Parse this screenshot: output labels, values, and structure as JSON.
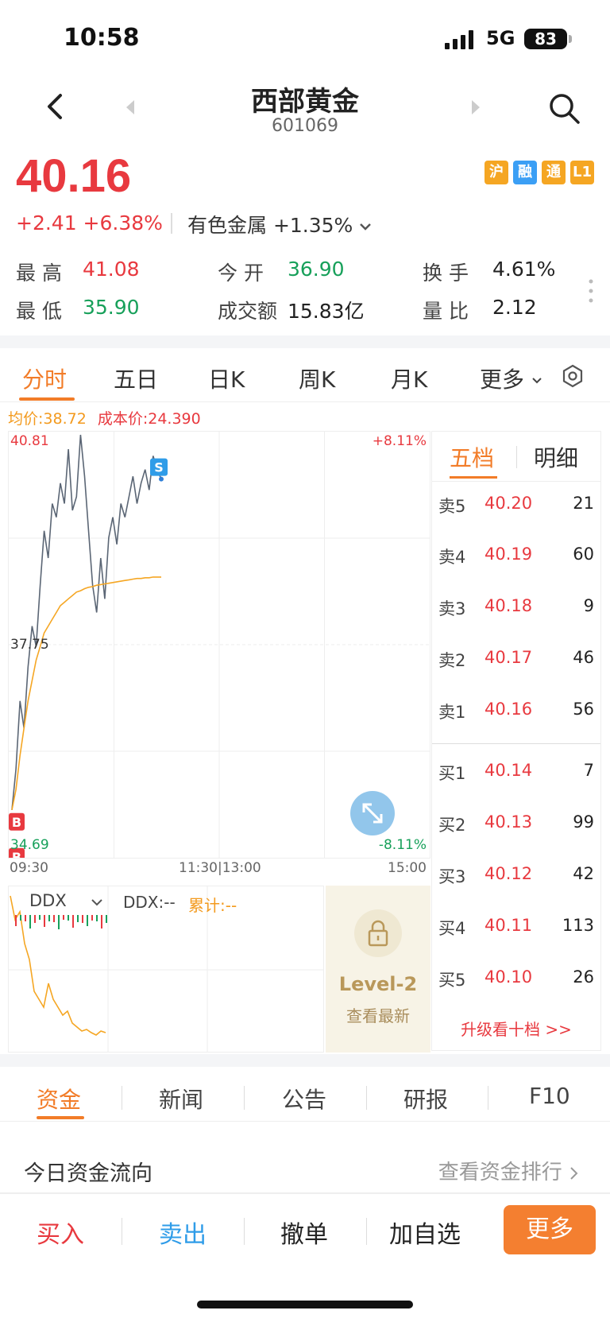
{
  "status_bar": {
    "time": "10:58",
    "network": "5G",
    "battery": "83"
  },
  "nav": {
    "name": "西部黄金",
    "code": "601069"
  },
  "header": {
    "price": "40.16",
    "change": "+2.41  +6.38%",
    "sector": "有色金属 +1.35%",
    "badges": [
      {
        "label": "沪",
        "color": "#f5a623"
      },
      {
        "label": "融",
        "color": "#3b9ff5"
      },
      {
        "label": "通",
        "color": "#f5a623"
      },
      {
        "label": "L1",
        "color": "#f5a623"
      }
    ]
  },
  "stats": {
    "high_label": "最  高",
    "high": "41.08",
    "low_label": "最  低",
    "low": "35.90",
    "open_label": "今  开",
    "open": "36.90",
    "amount_label": "成交额",
    "amount": "15.83亿",
    "turnover_label": "换  手",
    "turnover": "4.61%",
    "ratio_label": "量  比",
    "ratio": "2.12"
  },
  "chart_tabs": [
    "分时",
    "五日",
    "日K",
    "周K",
    "月K",
    "更多"
  ],
  "chart_info": {
    "avg_price": "均价:38.72",
    "cost_price": "成本价:24.390"
  },
  "chart_data": {
    "type": "line",
    "y_max_label": "40.81",
    "y_mid_label": "37.75",
    "y_min_label": "34.69",
    "pct_max_label": "+8.11%",
    "pct_min_label": "-8.11%",
    "x_labels": [
      "09:30",
      "11:30|13:00",
      "15:00"
    ],
    "ylim": [
      34.69,
      40.81
    ],
    "series": [
      {
        "values": [
          35.3,
          35.9,
          36.9,
          36.5,
          37.4,
          38.0,
          37.7,
          38.6,
          39.4,
          39.0,
          39.8,
          39.6,
          40.1,
          39.8,
          40.6,
          39.7,
          39.9,
          40.81,
          40.2,
          39.4,
          38.6,
          38.2,
          39.0,
          38.4,
          39.3,
          39.6,
          39.2,
          39.8,
          39.6,
          39.9,
          40.2,
          39.8,
          40.1,
          40.3,
          40.0,
          40.5,
          40.3,
          40.16
        ]
      },
      {
        "values": [
          35.3,
          35.6,
          36.1,
          36.5,
          36.9,
          37.2,
          37.5,
          37.7,
          37.9,
          38.0,
          38.1,
          38.2,
          38.3,
          38.35,
          38.4,
          38.45,
          38.5,
          38.52,
          38.55,
          38.57,
          38.58,
          38.6,
          38.61,
          38.62,
          38.63,
          38.64,
          38.65,
          38.66,
          38.67,
          38.68,
          38.69,
          38.7,
          38.7,
          38.71,
          38.71,
          38.72,
          38.72,
          38.72
        ]
      }
    ]
  },
  "markers": {
    "sell": "S",
    "buy": "B"
  },
  "orderbook": {
    "tabs": [
      "五档",
      "明细"
    ],
    "asks": [
      {
        "label": "卖5",
        "price": "40.20",
        "vol": "21"
      },
      {
        "label": "卖4",
        "price": "40.19",
        "vol": "60"
      },
      {
        "label": "卖3",
        "price": "40.18",
        "vol": "9"
      },
      {
        "label": "卖2",
        "price": "40.17",
        "vol": "46"
      },
      {
        "label": "卖1",
        "price": "40.16",
        "vol": "56"
      }
    ],
    "bids": [
      {
        "label": "买1",
        "price": "40.14",
        "vol": "7"
      },
      {
        "label": "买2",
        "price": "40.13",
        "vol": "99"
      },
      {
        "label": "买3",
        "price": "40.12",
        "vol": "42"
      },
      {
        "label": "买4",
        "price": "40.11",
        "vol": "113"
      },
      {
        "label": "买5",
        "price": "40.10",
        "vol": "26"
      }
    ],
    "upgrade": "升级看十档 >>"
  },
  "ddx": {
    "select": "DDX",
    "value": "DDX:--",
    "cumulative": "累计:--"
  },
  "level2": {
    "title": "Level-2",
    "subtitle": "查看最新"
  },
  "bottom_tabs": [
    "资金",
    "新闻",
    "公告",
    "研报",
    "F10"
  ],
  "fund": {
    "title": "今日资金流向",
    "link": "查看资金排行"
  },
  "actions": {
    "buy": "买入",
    "sell": "卖出",
    "cancel": "撤单",
    "watch": "加自选",
    "more": "更多"
  }
}
